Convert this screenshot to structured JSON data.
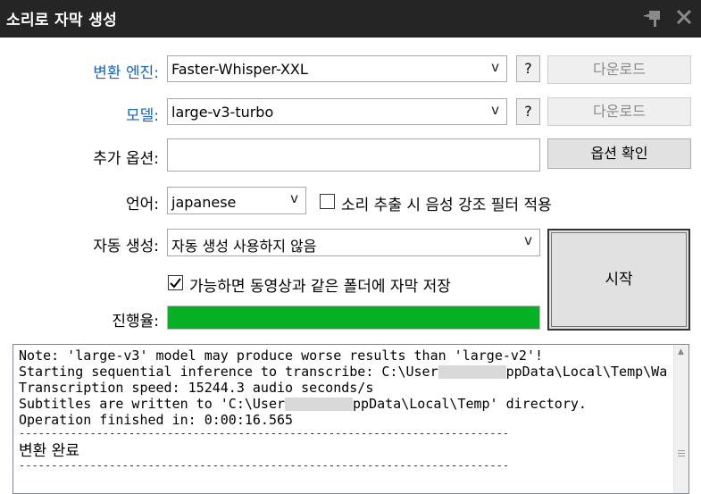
{
  "window": {
    "title": "소리로 자막 생성",
    "pin_icon": "pin-icon",
    "close_icon": "close-icon"
  },
  "form": {
    "engine": {
      "label": "변환 엔진:",
      "value": "Faster-Whisper-XXL",
      "help_label": "?",
      "download_label": "다운로드"
    },
    "model": {
      "label": "모델:",
      "value": "large-v3-turbo",
      "help_label": "?",
      "download_label": "다운로드"
    },
    "options": {
      "label": "추가 옵션:",
      "value": "",
      "check_button_label": "옵션 확인"
    },
    "language": {
      "label": "언어:",
      "value": "japanese"
    },
    "voice_filter": {
      "label": "소리 추출 시 음성 강조 필터 적용",
      "checked": false
    },
    "auto_generate": {
      "label": "자동 생성:",
      "value": "자동 생성 사용하지 않음"
    },
    "save_same_folder": {
      "label": "가능하면 동영상과 같은 폴더에 자막 저장",
      "checked": true
    },
    "progress": {
      "label": "진행율:",
      "percent": 100,
      "color": "#06b025"
    },
    "start_label": "시작",
    "dropdown_arrow": "v"
  },
  "log": {
    "lines": [
      "Note: 'large-v3' model may produce worse results than 'large-v2'!",
      "Starting sequential inference to transcribe: C:\\User",
      "ppData\\Local\\Temp\\Wa",
      "Transcription speed: 15244.3 audio seconds/s",
      "Subtitles are written to 'C:\\User",
      "ppData\\Local\\Temp' directory.",
      "Operation finished in: 0:00:16.565",
      "----------------------------------------------------------------------------",
      "변환 완료",
      "----------------------------------------------------------------------------"
    ]
  }
}
